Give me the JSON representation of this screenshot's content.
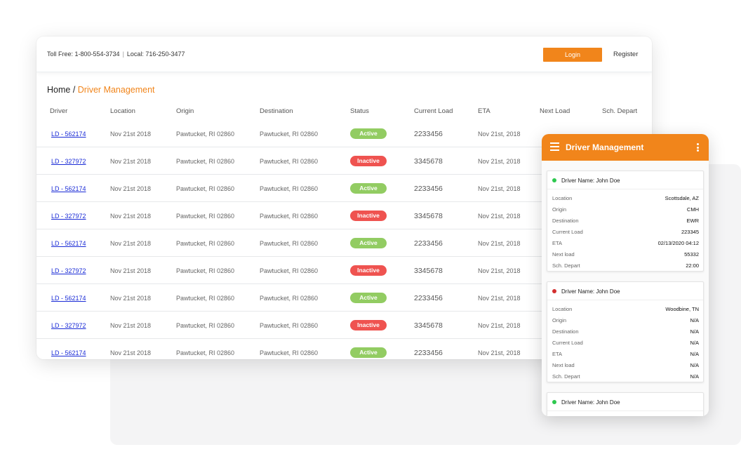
{
  "topbar": {
    "toll_free": "Toll Free: 1-800-554-3734",
    "separator": "|",
    "local": "Local: 716-250-3477",
    "login_label": "Login",
    "register_label": "Register"
  },
  "breadcrumb": {
    "home": "Home",
    "separator": " / ",
    "current": "Driver Management"
  },
  "table": {
    "columns": [
      "Driver",
      "Location",
      "Origin",
      "Destination",
      "Status",
      "Current Load",
      "ETA",
      "Next Load",
      "Sch. Depart"
    ],
    "rows": [
      {
        "driver": "LD - 562174",
        "location": "Nov 21st 2018",
        "origin": "Pawtucket, RI 02860",
        "destination": "Pawtucket, RI 02860",
        "status": "Active",
        "current_load": "2233456",
        "eta": "Nov 21st, 2018"
      },
      {
        "driver": "LD - 327972",
        "location": "Nov 21st 2018",
        "origin": "Pawtucket, RI 02860",
        "destination": "Pawtucket, RI 02860",
        "status": "Inactive",
        "current_load": "3345678",
        "eta": "Nov 21st, 2018"
      },
      {
        "driver": "LD - 562174",
        "location": "Nov 21st 2018",
        "origin": "Pawtucket, RI 02860",
        "destination": "Pawtucket, RI 02860",
        "status": "Active",
        "current_load": "2233456",
        "eta": "Nov 21st, 2018"
      },
      {
        "driver": "LD - 327972",
        "location": "Nov 21st 2018",
        "origin": "Pawtucket, RI 02860",
        "destination": "Pawtucket, RI 02860",
        "status": "Inactive",
        "current_load": "3345678",
        "eta": "Nov 21st, 2018"
      },
      {
        "driver": "LD - 562174",
        "location": "Nov 21st 2018",
        "origin": "Pawtucket, RI 02860",
        "destination": "Pawtucket, RI 02860",
        "status": "Active",
        "current_load": "2233456",
        "eta": "Nov 21st, 2018"
      },
      {
        "driver": "LD - 327972",
        "location": "Nov 21st 2018",
        "origin": "Pawtucket, RI 02860",
        "destination": "Pawtucket, RI 02860",
        "status": "Inactive",
        "current_load": "3345678",
        "eta": "Nov 21st, 2018"
      },
      {
        "driver": "LD - 562174",
        "location": "Nov 21st 2018",
        "origin": "Pawtucket, RI 02860",
        "destination": "Pawtucket, RI 02860",
        "status": "Active",
        "current_load": "2233456",
        "eta": "Nov 21st, 2018"
      },
      {
        "driver": "LD - 327972",
        "location": "Nov 21st 2018",
        "origin": "Pawtucket, RI 02860",
        "destination": "Pawtucket, RI 02860",
        "status": "Inactive",
        "current_load": "3345678",
        "eta": "Nov 21st, 2018"
      },
      {
        "driver": "LD - 562174",
        "location": "Nov 21st 2018",
        "origin": "Pawtucket, RI 02860",
        "destination": "Pawtucket, RI 02860",
        "status": "Active",
        "current_load": "2233456",
        "eta": "Nov 21st, 2018"
      }
    ]
  },
  "mobile": {
    "title": "Driver Management",
    "menu_icon": "hamburger-icon",
    "more_icon": "kebab-icon",
    "cards": [
      {
        "status_color": "green",
        "name": "Driver Name: John Doe",
        "fields": [
          {
            "label": "Location",
            "value": "Scottsdale, AZ"
          },
          {
            "label": "Origin",
            "value": "CMH"
          },
          {
            "label": "Destination",
            "value": "EWR"
          },
          {
            "label": "Current Load",
            "value": "223345"
          },
          {
            "label": "ETA",
            "value": "02/13/2020 04:12"
          },
          {
            "label": "Next load",
            "value": "55332"
          },
          {
            "label": "Sch. Depart",
            "value": "22:00"
          }
        ]
      },
      {
        "status_color": "red",
        "name": "Driver Name: John Doe",
        "fields": [
          {
            "label": "Location",
            "value": "Woodbine, TN"
          },
          {
            "label": "Origin",
            "value": "N/A"
          },
          {
            "label": "Destination",
            "value": "N/A"
          },
          {
            "label": "Current Load",
            "value": "N/A"
          },
          {
            "label": "ETA",
            "value": "N/A"
          },
          {
            "label": "Next load",
            "value": "N/A"
          },
          {
            "label": "Sch. Depart",
            "value": "N/A"
          }
        ]
      },
      {
        "status_color": "green",
        "name": "Driver Name: John Doe",
        "fields": []
      }
    ]
  },
  "colors": {
    "accent": "#f1851b",
    "active": "#92cc62",
    "inactive": "#ef5350",
    "link": "#1a2bd6",
    "dot_green": "#2ec84f",
    "dot_red": "#d32f2f"
  }
}
